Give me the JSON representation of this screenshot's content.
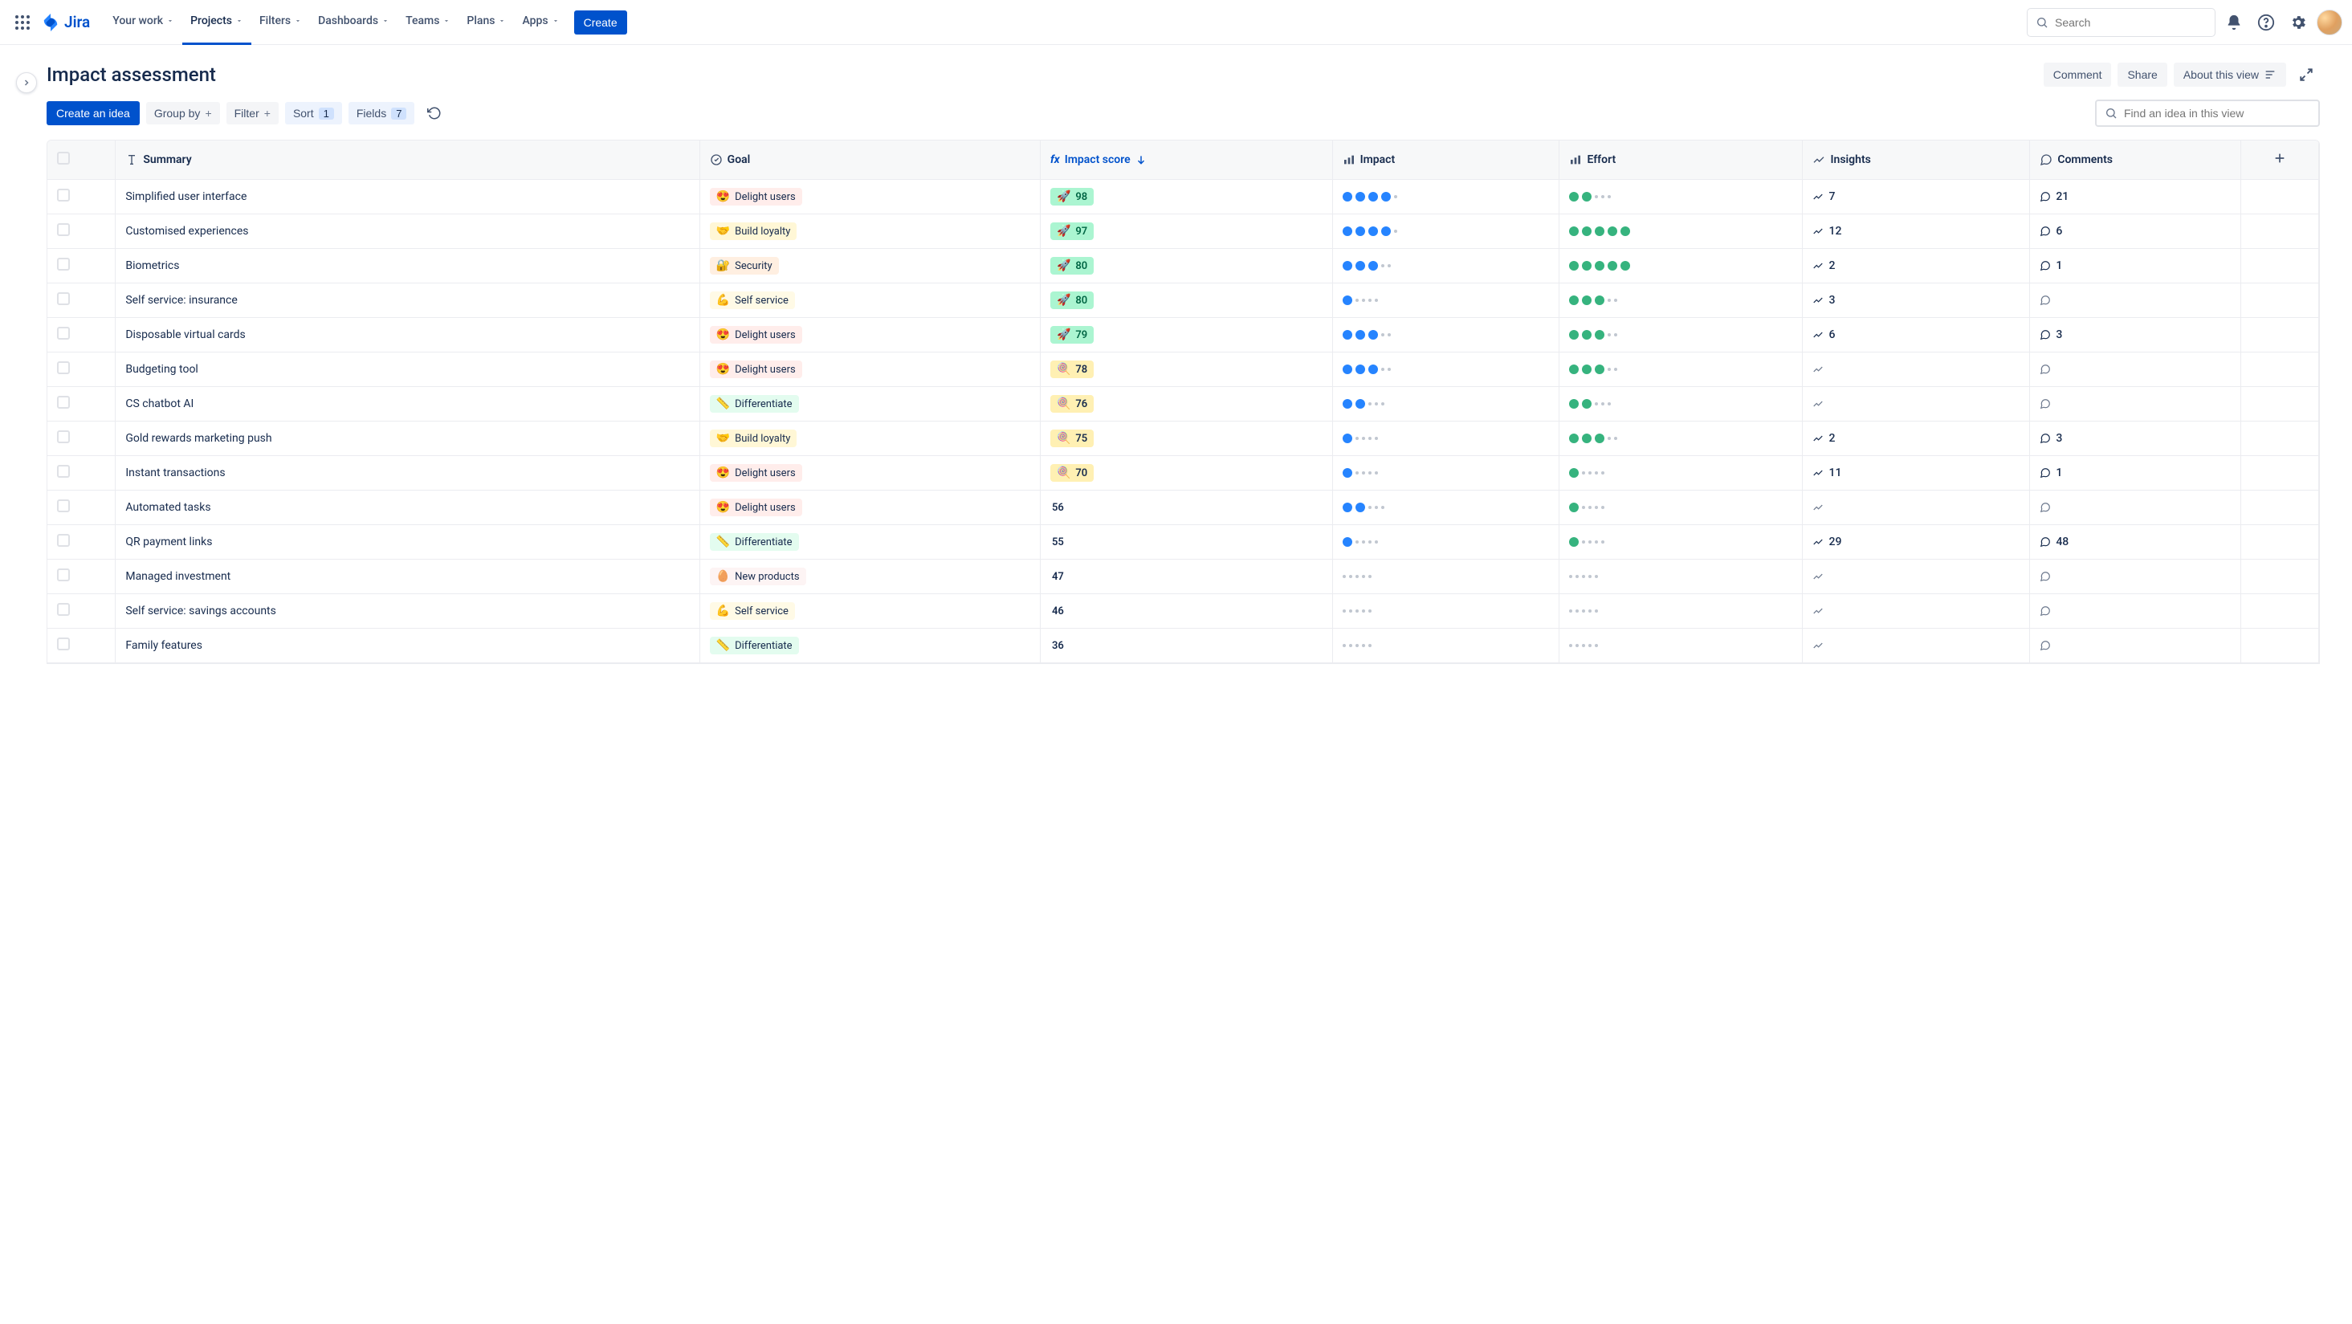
{
  "topnav": {
    "product": "Jira",
    "items": [
      "Your work",
      "Projects",
      "Filters",
      "Dashboards",
      "Teams",
      "Plans",
      "Apps"
    ],
    "active_index": 1,
    "create_label": "Create",
    "search_placeholder": "Search"
  },
  "page": {
    "title": "Impact assessment",
    "comment_label": "Comment",
    "share_label": "Share",
    "about_label": "About this view"
  },
  "toolbar": {
    "create_idea": "Create an idea",
    "group_by": "Group by",
    "filter": "Filter",
    "sort": "Sort",
    "sort_count": "1",
    "fields": "Fields",
    "fields_count": "7",
    "find_placeholder": "Find an idea in this view"
  },
  "columns": {
    "summary": "Summary",
    "goal": "Goal",
    "impact_score": "Impact score",
    "impact": "Impact",
    "effort": "Effort",
    "insights": "Insights",
    "comments": "Comments"
  },
  "goals": {
    "delight": {
      "emoji": "😍",
      "label": "Delight users",
      "bg": "#FFEDEB"
    },
    "loyalty": {
      "emoji": "🤝",
      "label": "Build loyalty",
      "bg": "#FFF7D6"
    },
    "security": {
      "emoji": "🔐",
      "label": "Security",
      "bg": "#FFEFE1"
    },
    "selfservice": {
      "emoji": "💪",
      "label": "Self service",
      "bg": "#FFFAE6"
    },
    "differentiate": {
      "emoji": "📏",
      "label": "Differentiate",
      "bg": "#E3FCEF"
    },
    "newproducts": {
      "emoji": "🥚",
      "label": "New products",
      "bg": "#FDF4F4"
    }
  },
  "rows": [
    {
      "summary": "Simplified user interface",
      "goal": "delight",
      "score": 98,
      "score_tier": "high",
      "impact": 4,
      "effort": 2,
      "insights": 7,
      "comments": 21
    },
    {
      "summary": "Customised experiences",
      "goal": "loyalty",
      "score": 97,
      "score_tier": "high",
      "impact": 4,
      "effort": 5,
      "insights": 12,
      "comments": 6
    },
    {
      "summary": "Biometrics",
      "goal": "security",
      "score": 80,
      "score_tier": "high",
      "impact": 3,
      "effort": 5,
      "insights": 2,
      "comments": 1
    },
    {
      "summary": "Self service: insurance",
      "goal": "selfservice",
      "score": 80,
      "score_tier": "high",
      "impact": 1,
      "effort": 3,
      "insights": 3,
      "comments": null
    },
    {
      "summary": "Disposable virtual cards",
      "goal": "delight",
      "score": 79,
      "score_tier": "high",
      "impact": 3,
      "effort": 3,
      "insights": 6,
      "comments": 3
    },
    {
      "summary": "Budgeting tool",
      "goal": "delight",
      "score": 78,
      "score_tier": "mid",
      "impact": 3,
      "effort": 3,
      "insights": null,
      "comments": null
    },
    {
      "summary": "CS chatbot AI",
      "goal": "differentiate",
      "score": 76,
      "score_tier": "mid",
      "impact": 2,
      "effort": 2,
      "insights": null,
      "comments": null
    },
    {
      "summary": "Gold rewards marketing push",
      "goal": "loyalty",
      "score": 75,
      "score_tier": "mid",
      "impact": 1,
      "effort": 3,
      "insights": 2,
      "comments": 3
    },
    {
      "summary": "Instant transactions",
      "goal": "delight",
      "score": 70,
      "score_tier": "mid",
      "impact": 1,
      "effort": 1,
      "insights": 11,
      "comments": 1
    },
    {
      "summary": "Automated tasks",
      "goal": "delight",
      "score": 56,
      "score_tier": "low",
      "impact": 2,
      "effort": 1,
      "insights": null,
      "comments": null
    },
    {
      "summary": "QR payment links",
      "goal": "differentiate",
      "score": 55,
      "score_tier": "low",
      "impact": 1,
      "effort": 1,
      "insights": 29,
      "comments": 48
    },
    {
      "summary": "Managed investment",
      "goal": "newproducts",
      "score": 47,
      "score_tier": "low",
      "impact": 0,
      "effort": 0,
      "insights": null,
      "comments": null
    },
    {
      "summary": "Self service: savings accounts",
      "goal": "selfservice",
      "score": 46,
      "score_tier": "low",
      "impact": 0,
      "effort": 0,
      "insights": null,
      "comments": null
    },
    {
      "summary": "Family features",
      "goal": "differentiate",
      "score": 36,
      "score_tier": "low",
      "impact": 0,
      "effort": 0,
      "insights": null,
      "comments": null
    }
  ]
}
